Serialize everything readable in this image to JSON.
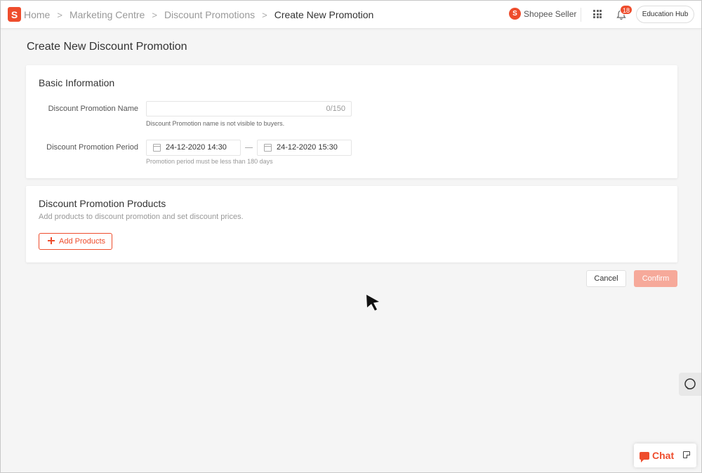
{
  "brand": {
    "logo_letter": "S",
    "accent": "#ee4d2d",
    "seller_label": "Shopee Seller"
  },
  "breadcrumb": [
    "Home",
    "Marketing Centre",
    "Discount Promotions",
    "Create New Promotion"
  ],
  "header": {
    "icons": [
      "apps-grid-icon",
      "bell-icon"
    ],
    "notification_count": "18",
    "education_hub": "Education Hub"
  },
  "page_title": "Create New Discount Promotion",
  "basic_info": {
    "title": "Basic Information",
    "name_label": "Discount Promotion Name",
    "name_value": "",
    "name_counter": "0/150",
    "name_hint": "Discount Promotion name is not visible to buyers.",
    "period_label": "Discount Promotion Period",
    "start_date": "24-12-2020 14:30",
    "end_date": "24-12-2020 15:30",
    "period_hint": "Promotion period must be less than 180 days"
  },
  "products": {
    "title": "Discount Promotion Products",
    "description": "Add products to discount promotion and set discount prices.",
    "add_button": "Add Products"
  },
  "actions": {
    "cancel": "Cancel",
    "confirm": "Confirm"
  },
  "chat": {
    "label": "Chat"
  }
}
